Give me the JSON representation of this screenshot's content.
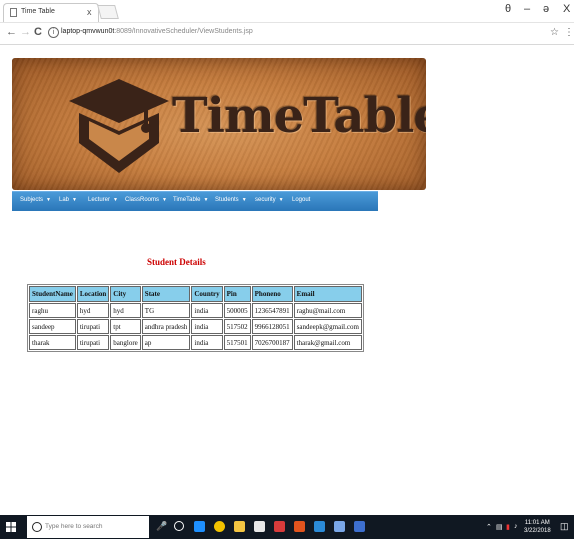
{
  "browser": {
    "tab_title": "Time Table",
    "close_glyph": "x",
    "url_host": "laptop-qmvwun0t",
    "url_rest": ":8089/InnovativeScheduler/ViewStudents.jsp",
    "window": {
      "account": "θ",
      "minimize": "–",
      "restore": "ə",
      "close": "X"
    }
  },
  "banner": {
    "logo_text": "TimeTable"
  },
  "navbar": {
    "items": [
      {
        "label": "Subjects",
        "has_caret": true
      },
      {
        "label": "Lab",
        "has_caret": true
      },
      {
        "label": "Lecturer",
        "has_caret": true
      },
      {
        "label": "ClassRooms",
        "has_caret": true
      },
      {
        "label": "TimeTable",
        "has_caret": true
      },
      {
        "label": "Students",
        "has_caret": true
      },
      {
        "label": "security",
        "has_caret": true
      },
      {
        "label": "Logout",
        "has_caret": false
      }
    ]
  },
  "section_title": "Student Details",
  "table": {
    "headers": [
      "StudentName",
      "Location",
      "City",
      "State",
      "Country",
      "Pin",
      "Phoneno",
      "Email"
    ],
    "rows": [
      [
        "raghu",
        "hyd",
        "hyd",
        "TG",
        "india",
        "500005",
        "1236547891",
        "raghu@mail.com"
      ],
      [
        "sandeep",
        "tirupati",
        "tpt",
        "andhra pradesh",
        "india",
        "517502",
        "9966128051",
        "sandeepk@gmail.com"
      ],
      [
        "tharak",
        "tirupati",
        "banglore",
        "ap",
        "india",
        "517501",
        "7026700187",
        "tharak@gmail.com"
      ]
    ]
  },
  "taskbar": {
    "search_placeholder": "Type here to search",
    "time": "11:01 AM",
    "date": "3/22/2018"
  },
  "colors": {
    "navbar": "#2a76b8",
    "table_header": "#87ceeb",
    "section_title": "#cc0000",
    "taskbar": "#101822"
  }
}
